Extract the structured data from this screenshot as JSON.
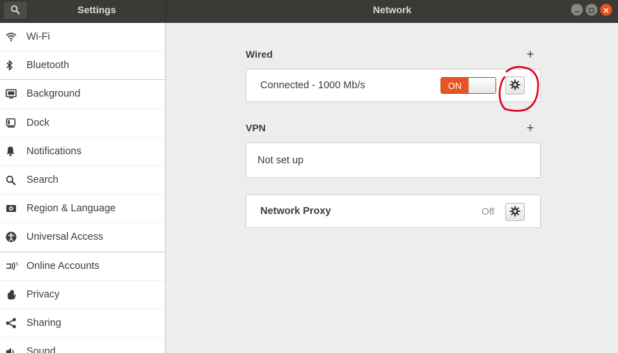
{
  "titlebar": {
    "left_title": "Settings",
    "center_title": "Network"
  },
  "sidebar": {
    "items": [
      {
        "label": "Wi-Fi",
        "icon": "wifi-icon"
      },
      {
        "label": "Bluetooth",
        "icon": "bluetooth-icon"
      },
      {
        "label": "Background",
        "icon": "background-icon"
      },
      {
        "label": "Dock",
        "icon": "dock-icon"
      },
      {
        "label": "Notifications",
        "icon": "bell-icon"
      },
      {
        "label": "Search",
        "icon": "search-icon"
      },
      {
        "label": "Region & Language",
        "icon": "region-icon"
      },
      {
        "label": "Universal Access",
        "icon": "accessibility-icon"
      },
      {
        "label": "Online Accounts",
        "icon": "online-accounts-icon"
      },
      {
        "label": "Privacy",
        "icon": "hand-icon"
      },
      {
        "label": "Sharing",
        "icon": "share-icon"
      },
      {
        "label": "Sound",
        "icon": "speaker-icon"
      }
    ]
  },
  "main": {
    "wired": {
      "title": "Wired",
      "add": "+",
      "status": "Connected - 1000 Mb/s",
      "switch_label": "ON",
      "switch_on": true
    },
    "vpn": {
      "title": "VPN",
      "add": "+",
      "status": "Not set up"
    },
    "proxy": {
      "title": "Network Proxy",
      "state": "Off"
    }
  },
  "colors": {
    "accent": "#e95420",
    "annotation": "#e3001b",
    "titlebar": "#3a3a37"
  }
}
